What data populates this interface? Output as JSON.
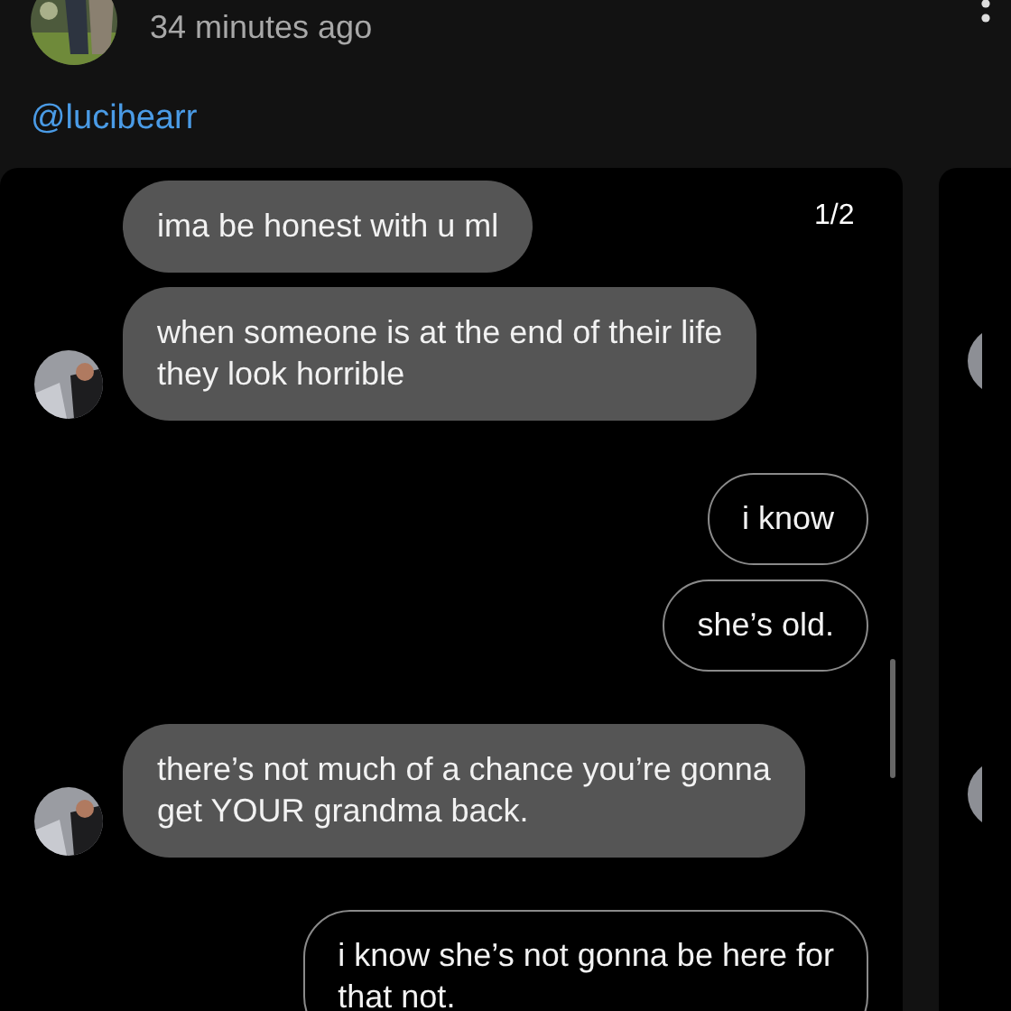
{
  "post": {
    "time": "34 minutes ago",
    "mention": "@lucibearr"
  },
  "screenshot": {
    "counter": "1/2",
    "messages": [
      {
        "kind": "received",
        "show_avatar": false,
        "lines": [
          "ima be honest with u ml"
        ]
      },
      {
        "kind": "received",
        "show_avatar": true,
        "lines": [
          "when someone is at the end of their life",
          "they look horrible"
        ]
      },
      {
        "kind": "sent",
        "lines": [
          "i know"
        ]
      },
      {
        "kind": "sent",
        "lines": [
          "she’s old."
        ]
      },
      {
        "kind": "received",
        "show_avatar": true,
        "lines": [
          "there’s not much of a chance you’re gonna",
          "get YOUR grandma back."
        ]
      },
      {
        "kind": "sent",
        "lines": [
          "i know she’s not gonna be here for",
          "that not."
        ]
      }
    ]
  }
}
